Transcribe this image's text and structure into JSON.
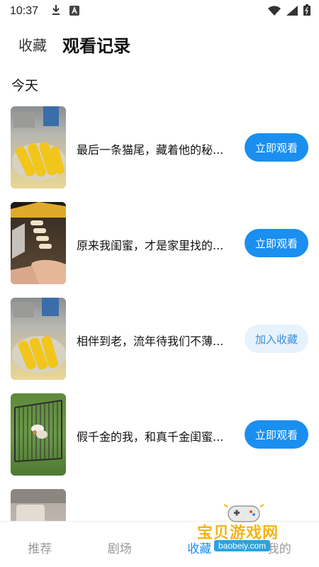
{
  "status_bar": {
    "time": "10:37",
    "icons": [
      "download-icon",
      "font-icon",
      "wifi-icon",
      "signal-icon",
      "battery-icon"
    ]
  },
  "header": {
    "tab_favorites": "收藏",
    "tab_history": "观看记录"
  },
  "section_title": "今天",
  "list": [
    {
      "title": "最后一条猫尾，藏着他的秘...",
      "button": "立即观看",
      "button_style": "primary"
    },
    {
      "title": "原来我闺蜜，才是家里找的...",
      "button": "立即观看",
      "button_style": "primary"
    },
    {
      "title": "相伴到老，流年待我们不薄...",
      "button": "加入收藏",
      "button_style": "secondary"
    },
    {
      "title": "假千金的我，和真千金闺蜜...",
      "button": "立即观看",
      "button_style": "primary"
    }
  ],
  "bottom_nav": {
    "items": [
      "推荐",
      "剧场",
      "收藏",
      "我的"
    ],
    "active_index": 2
  },
  "watermark": {
    "text": "宝贝游戏网",
    "url": "baobeiy.com"
  },
  "colors": {
    "accent": "#1a8ff0",
    "secondary_btn_bg": "#e6f2fc",
    "watermark": "#f5b415"
  }
}
